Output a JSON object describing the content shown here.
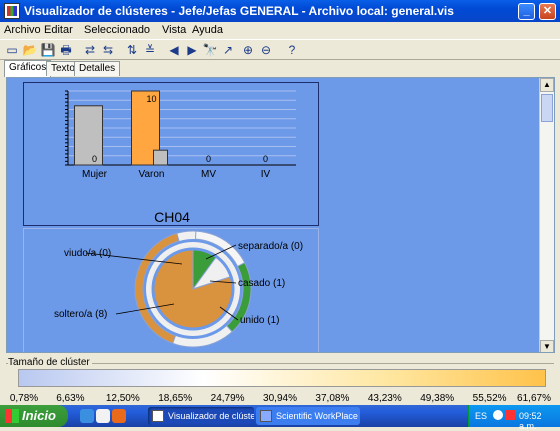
{
  "window": {
    "title": "Visualizador de clústeres - Jefe/Jefas GENERAL - Archivo local: general.vis",
    "buttons": {
      "minimize": "_",
      "maximize": "□",
      "close": "✕"
    }
  },
  "menu": [
    "Archivo",
    "Editar",
    "Seleccionado",
    "Vista",
    "Ayuda"
  ],
  "toolbar": [
    "new-icon",
    "open-icon",
    "save-icon",
    "print-icon",
    "redo-icon",
    "undo-icon",
    "sort-icon",
    "filter-icon",
    "back-icon",
    "forward-icon",
    "binoculars-icon",
    "pointer-icon",
    "zoom-in-icon",
    "zoom-out-icon",
    "help-icon"
  ],
  "toolbar_glyphs": [
    "▭",
    "📂",
    "💾",
    "🖶",
    "⇄",
    "⇆",
    "⇅",
    "≚",
    "◀",
    "▶",
    "🔭",
    "↗",
    "⊕",
    "⊖",
    "?"
  ],
  "tabs": [
    "Gráficos",
    "Texto",
    "Detalles"
  ],
  "cluster": {
    "label": "CH04"
  },
  "chart_data": [
    {
      "type": "bar",
      "categories": [
        "Mujer",
        "Varon",
        "MV",
        "IV"
      ],
      "series": [
        {
          "values": [
            8,
            10,
            0,
            0
          ]
        },
        {
          "values": [
            0,
            2,
            0,
            0
          ]
        }
      ],
      "data_labels": [
        "0",
        "10",
        "0",
        "0"
      ],
      "ylim": [
        0,
        10
      ],
      "colors": [
        "#BFBFBF",
        "#FFA640",
        "#BFBFBF"
      ],
      "grid": true
    },
    {
      "type": "pie",
      "categories": [
        "viudo/a (0)",
        "separado/a (0)",
        "casado (1)",
        "unido (1)",
        "soltero/a (8)"
      ],
      "values": [
        0,
        0,
        1,
        1,
        8
      ],
      "colors": {
        "soltero": "#D9923E",
        "casado": "#3A9D3A",
        "unido": "#3A9D3A",
        "background": "#F0F0F0"
      }
    }
  ],
  "legend": {
    "title": "Tamaño de clúster",
    "ticks": [
      "0,78%",
      "6,63%",
      "12,50%",
      "18,65%",
      "24,79%",
      "30,94%",
      "37,08%",
      "43,23%",
      "49,38%",
      "55,52%",
      "61,67%"
    ]
  },
  "taskbar": {
    "start_label": "Inicio",
    "tasks": [
      "Visualizador de clúste...",
      "Scientific WorkPlace -..."
    ],
    "tray_lang": "ES",
    "clock": "09:52 a.m."
  }
}
